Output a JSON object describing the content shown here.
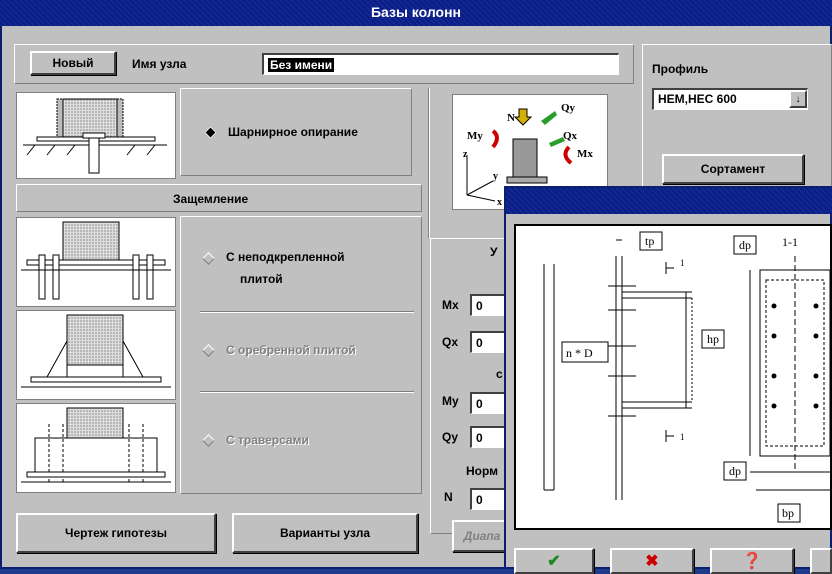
{
  "window": {
    "title": "Базы колонн"
  },
  "header": {
    "new_button": "Новый",
    "node_name_label": "Имя узла",
    "node_name_value": "Без имени"
  },
  "options": {
    "hinged": "Шарнирное опирание",
    "clamping_header": "Защемление",
    "unreinforced_line1": "С неподкрепленной",
    "unreinforced_line2": "плитой",
    "ribbed": "С оребренной плитой",
    "traverse": "С траверсами"
  },
  "profile": {
    "label": "Профиль",
    "selected": "HEM,HEC 600",
    "sortament_button": "Сортамент"
  },
  "loads": {
    "section_label_partial": "У",
    "mx_label": "Mx",
    "mx_value": "0",
    "qx_label": "Qx",
    "qx_value": "0",
    "section2_partial": "с",
    "my_label": "My",
    "my_value": "0",
    "qy_label": "Qy",
    "qy_value": "0",
    "normal_label_partial": "Норм",
    "n_label": "N",
    "n_value": "0",
    "range_button_partial": "Диапа"
  },
  "forces_diagram": {
    "n": "N",
    "qy": "Qy",
    "my": "My",
    "qx": "Qx",
    "mx": "Mx",
    "z": "z",
    "y": "y",
    "x": "x"
  },
  "bottom": {
    "drawing_button": "Чертеж гипотезы",
    "variants_button": "Варианты узла"
  },
  "detail_drawing": {
    "tp": "tp",
    "dp_top": "dp",
    "section": "1-1",
    "n_d": "n * D",
    "hp": "hp",
    "dp_bottom": "dp",
    "bp": "bp",
    "one": "1"
  }
}
